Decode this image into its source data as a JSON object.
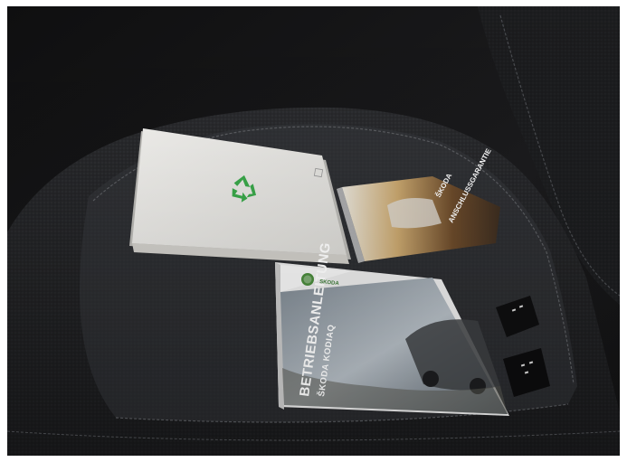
{
  "manual": {
    "title": "BETRIEBSANLEITUNG",
    "subtitle": "ŠKODA KODIAQ",
    "brand": "ŠKODA"
  },
  "brochure": {
    "line1": "ŠKODA",
    "line2": "ANSCHLUSSGARANTIE"
  },
  "folder": {
    "symbol": "recycle-icon"
  },
  "colors": {
    "seat_fabric": "#2a2b2d",
    "background": "#151516",
    "manual_green": "#4a8a3c",
    "folder_white": "#ecebe8",
    "recycle_green": "#3aa84a"
  }
}
